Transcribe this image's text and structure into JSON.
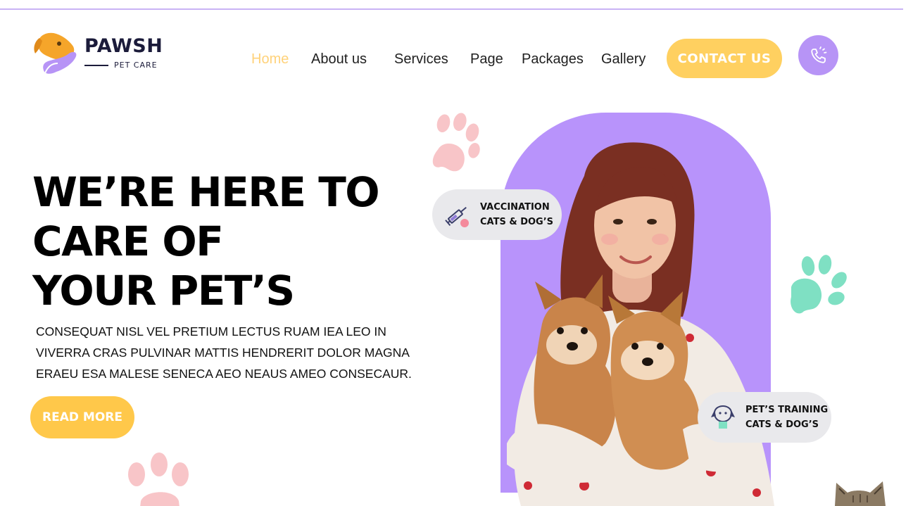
{
  "brand": {
    "name": "PAWSH",
    "tagline": "PET CARE"
  },
  "nav": {
    "items": [
      {
        "label": "Home",
        "active": true
      },
      {
        "label": "About us"
      },
      {
        "label": "Services"
      },
      {
        "label": "Page"
      },
      {
        "label": "Packages"
      },
      {
        "label": "Gallery"
      }
    ],
    "contact_label": "CONTACT US",
    "call_icon": "phone-ring-icon"
  },
  "hero": {
    "title_lines": [
      "WE’RE HERE TO",
      "CARE OF",
      "YOUR PET’S"
    ],
    "description_lines": [
      "CONSEQUAT NISL VEL PRETIUM LECTUS RUAM IEA LEO IN",
      "VIVERRA CRAS PULVINAR MATTIS HENDRERIT DOLOR MAGNA",
      "ERAEU ESA MALESE SENECA AEO NEAUS AMEO CONSECAUR."
    ],
    "cta_label": "READ MORE"
  },
  "badges": {
    "vaccination": {
      "line1": "VACCINATION",
      "line2": "CATS & DOG’S",
      "icon": "syringe-icon"
    },
    "training": {
      "line1": "PET’S TRAINING",
      "line2": "CATS & DOG’S",
      "icon": "dog-training-icon"
    }
  },
  "colors": {
    "accent_purple": "#b893fb",
    "accent_yellow": "#ffc84a",
    "nav_active": "#ffd27a",
    "paw_pink": "#f8c5c8",
    "paw_green": "#7fe0c3"
  }
}
